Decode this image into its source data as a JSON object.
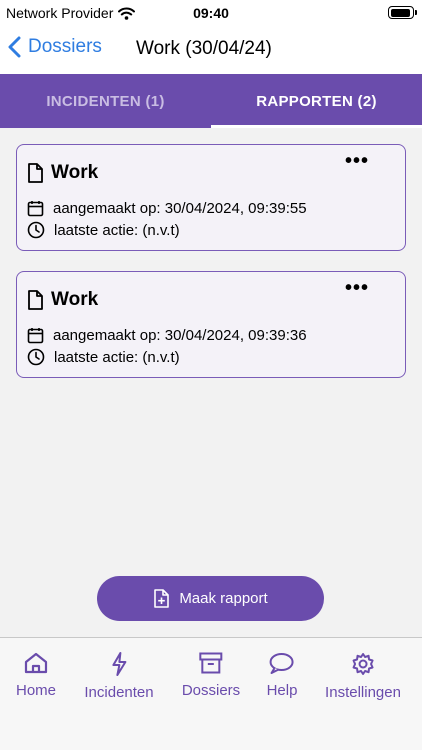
{
  "status_bar": {
    "carrier": "Network Provider",
    "time": "09:40",
    "battery_level": 0.95
  },
  "nav": {
    "back_label": "Dossiers",
    "title": "Work (30/04/24)"
  },
  "tabs": [
    {
      "label": "INCIDENTEN (1)",
      "active": false
    },
    {
      "label": "RAPPORTEN (2)",
      "active": true
    }
  ],
  "reports": [
    {
      "title": "Work",
      "created": "aangemaakt op: 30/04/2024, 09:39:55",
      "last_action": "laatste actie: (n.v.t)",
      "menu": "•••"
    },
    {
      "title": "Work",
      "created": "aangemaakt op: 30/04/2024, 09:39:36",
      "last_action": "laatste actie: (n.v.t)",
      "menu": "•••"
    }
  ],
  "primary_action": {
    "label": "Maak rapport",
    "icon": "file-plus-icon"
  },
  "tab_bar": [
    {
      "label": "Home",
      "icon": "home-icon"
    },
    {
      "label": "Incidenten",
      "icon": "lightning-icon"
    },
    {
      "label": "Dossiers",
      "icon": "archive-icon"
    },
    {
      "label": "Help",
      "icon": "chat-bubble-icon"
    },
    {
      "label": "Instellingen",
      "icon": "gear-icon"
    }
  ],
  "colors": {
    "accent": "#6a4cac",
    "link": "#2f7de1",
    "background": "#f2f2f2"
  }
}
